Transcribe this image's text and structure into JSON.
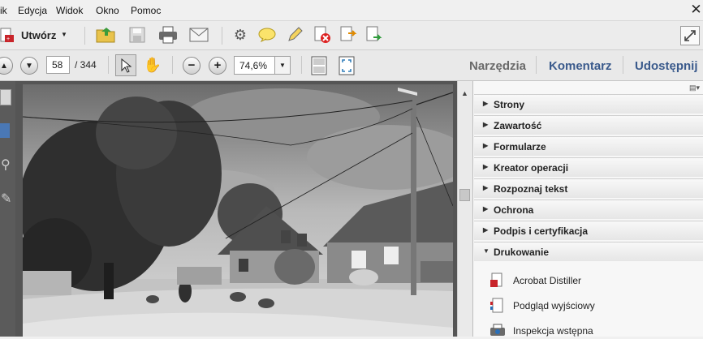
{
  "menu": [
    "ik",
    "Edycja",
    "Widok",
    "Okno",
    "Pomoc"
  ],
  "toolbar": {
    "create_label": "Utwórz"
  },
  "nav": {
    "page_value": "58",
    "page_total": "/ 344",
    "zoom_value": "74,6%"
  },
  "right_tabs": {
    "tools": "Narzędzia",
    "comment": "Komentarz",
    "share": "Udostępnij"
  },
  "panel": {
    "sections": [
      "Strony",
      "Zawartość",
      "Formularze",
      "Kreator operacji",
      "Rozpoznaj tekst",
      "Ochrona",
      "Podpis i certyfikacja",
      "Drukowanie"
    ],
    "expanded_section": "Drukowanie",
    "print_items": [
      "Acrobat Distiller",
      "Podgląd wyjściowy",
      "Inspekcja wstępna"
    ]
  },
  "colors": {
    "accent_link": "#3a5a8c",
    "panel_header": "#e6e6e6",
    "doc_bg": "#555555"
  }
}
